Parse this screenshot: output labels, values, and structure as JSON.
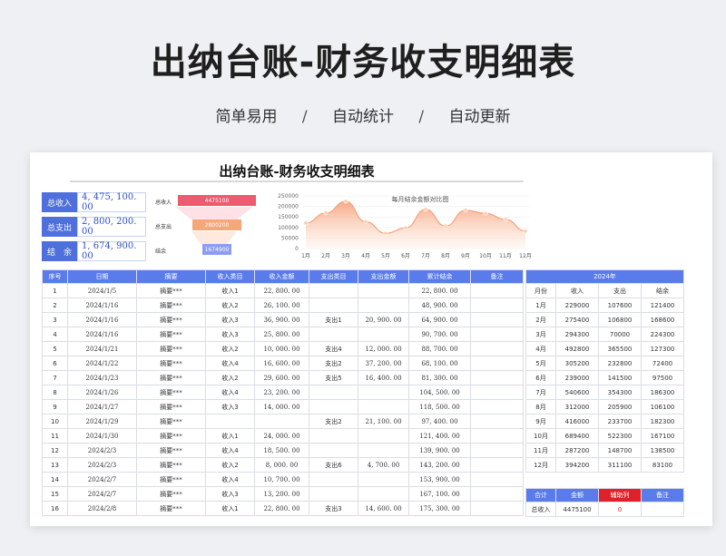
{
  "header": {
    "title": "出纳台账-财务收支明细表",
    "tags": [
      "简单易用",
      "自动统计",
      "自动更新"
    ],
    "sep": "/"
  },
  "sheet": {
    "title": "出纳台账-财务收支明细表"
  },
  "summary": [
    {
      "label": "总收入",
      "value": "4, 475, 100. 00"
    },
    {
      "label": "总支出",
      "value": "2, 800, 200. 00"
    },
    {
      "label": "结　余",
      "value": "1, 674, 900. 00"
    }
  ],
  "funnel": [
    {
      "label": "总收入",
      "value": "4475100",
      "color": "#ec5b70",
      "fraction": 1.0
    },
    {
      "label": "总支出",
      "value": "2800200",
      "color": "#f6a77a",
      "fraction": 0.626
    },
    {
      "label": "结余",
      "value": "1674900",
      "color": "#8d9df0",
      "fraction": 0.374
    }
  ],
  "chart_data": {
    "type": "area",
    "title": "每月结余金额对比图",
    "categories": [
      "1月",
      "2月",
      "3月",
      "4月",
      "5月",
      "6月",
      "7月",
      "8月",
      "9月",
      "10月",
      "11月",
      "12月"
    ],
    "values": [
      121400,
      168600,
      224300,
      127300,
      72400,
      97500,
      186300,
      106100,
      182300,
      167100,
      138500,
      83100
    ],
    "ylim": [
      0,
      250000
    ],
    "yticks": [
      "0",
      "50000",
      "100000",
      "150000",
      "200000",
      "250000"
    ],
    "colors": {
      "line": "#f5a27a",
      "fill_top": "#f6a07a",
      "fill_bottom": "#fff2ea",
      "point": "#fbd0b4"
    }
  },
  "ledger": {
    "columns": [
      "序号",
      "日期",
      "摘要",
      "收入类目",
      "收入金额",
      "支出类目",
      "支出金额",
      "累计结余",
      "备注"
    ],
    "rows": [
      [
        "1",
        "2024/1/5",
        "摘要***",
        "收入1",
        "22, 800. 00",
        "",
        "",
        "22, 800. 00",
        ""
      ],
      [
        "2",
        "2024/1/16",
        "摘要***",
        "收入2",
        "26, 100. 00",
        "",
        "",
        "48, 900. 00",
        ""
      ],
      [
        "3",
        "2024/1/16",
        "摘要***",
        "收入3",
        "36, 900. 00",
        "支出1",
        "20, 900. 00",
        "64, 900. 00",
        ""
      ],
      [
        "4",
        "2024/1/16",
        "摘要***",
        "收入3",
        "25, 800. 00",
        "",
        "",
        "90, 700. 00",
        ""
      ],
      [
        "5",
        "2024/1/21",
        "摘要***",
        "收入2",
        "10, 000. 00",
        "支出4",
        "12, 000. 00",
        "88, 700. 00",
        ""
      ],
      [
        "6",
        "2024/1/22",
        "摘要***",
        "收入4",
        "16, 600. 00",
        "支出2",
        "37, 200. 00",
        "68, 100. 00",
        ""
      ],
      [
        "7",
        "2024/1/23",
        "摘要***",
        "收入2",
        "29, 600. 00",
        "支出5",
        "16, 400. 00",
        "81, 300. 00",
        ""
      ],
      [
        "8",
        "2024/1/26",
        "摘要***",
        "收入4",
        "23, 200. 00",
        "",
        "",
        "104, 500. 00",
        ""
      ],
      [
        "9",
        "2024/1/27",
        "摘要***",
        "收入3",
        "14, 000. 00",
        "",
        "",
        "118, 500. 00",
        ""
      ],
      [
        "10",
        "2024/1/29",
        "摘要***",
        "",
        "",
        "支出2",
        "21, 100. 00",
        "97, 400. 00",
        ""
      ],
      [
        "11",
        "2024/1/30",
        "摘要***",
        "收入1",
        "24, 000. 00",
        "",
        "",
        "121, 400. 00",
        ""
      ],
      [
        "12",
        "2024/2/3",
        "摘要***",
        "收入4",
        "18, 500. 00",
        "",
        "",
        "139, 900. 00",
        ""
      ],
      [
        "13",
        "2024/2/3",
        "摘要***",
        "收入2",
        "8, 000. 00",
        "支出6",
        "4, 700. 00",
        "143, 200. 00",
        ""
      ],
      [
        "14",
        "2024/2/7",
        "摘要***",
        "收入4",
        "10, 700. 00",
        "",
        "",
        "153, 900. 00",
        ""
      ],
      [
        "15",
        "2024/2/7",
        "摘要***",
        "收入3",
        "13, 200. 00",
        "",
        "",
        "167, 100. 00",
        ""
      ],
      [
        "16",
        "2024/2/8",
        "摘要***",
        "收入1",
        "22, 800. 00",
        "支出3",
        "14, 600. 00",
        "175, 300. 00",
        ""
      ]
    ]
  },
  "monthly": {
    "year_header": "2024年",
    "columns": [
      "月份",
      "收入",
      "支出",
      "结余"
    ],
    "rows": [
      [
        "1月",
        "229000",
        "107600",
        "121400"
      ],
      [
        "2月",
        "275400",
        "106800",
        "168600"
      ],
      [
        "3月",
        "294300",
        "70000",
        "224300"
      ],
      [
        "4月",
        "492800",
        "365500",
        "127300"
      ],
      [
        "5月",
        "305200",
        "232800",
        "72400"
      ],
      [
        "6月",
        "239000",
        "141500",
        "97500"
      ],
      [
        "7月",
        "540600",
        "354300",
        "186300"
      ],
      [
        "8月",
        "312000",
        "205900",
        "106100"
      ],
      [
        "9月",
        "416000",
        "233700",
        "182300"
      ],
      [
        "10月",
        "689400",
        "522300",
        "167100"
      ],
      [
        "11月",
        "287200",
        "148700",
        "138500"
      ],
      [
        "12月",
        "394200",
        "311100",
        "83100"
      ]
    ]
  },
  "totals": {
    "columns": [
      "合计",
      "金额",
      "辅助列",
      "备注"
    ],
    "rows": [
      [
        "总收入",
        "4475100",
        "0",
        ""
      ]
    ]
  }
}
